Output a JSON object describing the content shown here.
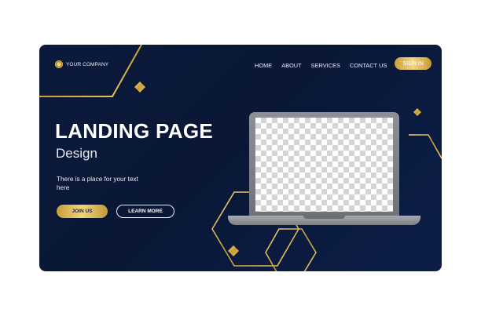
{
  "brand": {
    "name": "YOUR COMPANY",
    "logo_icon": "circle-logo-icon"
  },
  "nav": {
    "items": [
      "HOME",
      "ABOUT",
      "SERVICES",
      "CONTACT US"
    ],
    "signin_label": "SIGN IN"
  },
  "hero": {
    "title": "LANDING PAGE",
    "subtitle": "Design",
    "description": "There is a place for your text here",
    "join_label": "JOIN US",
    "learn_label": "LEARN MORE"
  },
  "colors": {
    "background": "#0b1a3c",
    "accent_gold": "#e2bd55",
    "text": "#ffffff"
  }
}
